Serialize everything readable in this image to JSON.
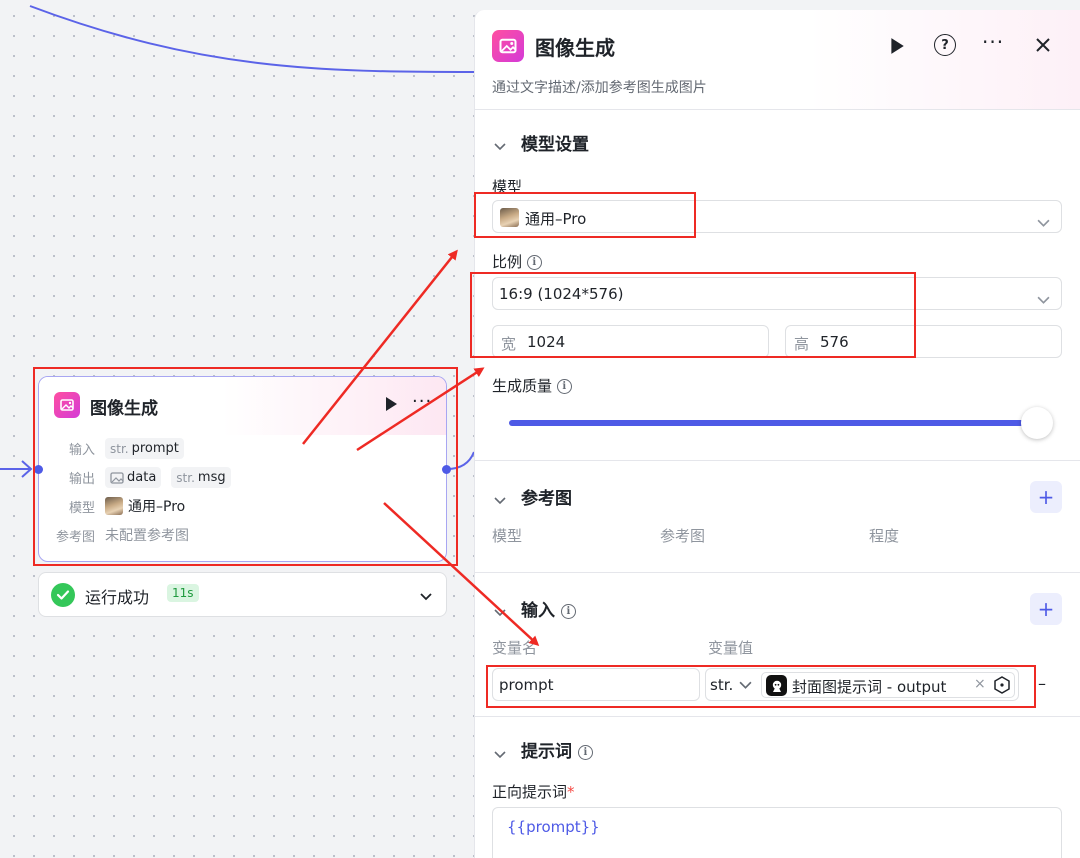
{
  "node": {
    "title": "图像生成",
    "input_label": "输入",
    "output_label": "输出",
    "model_label": "模型",
    "ref_label": "参考图",
    "input_var": {
      "type": "str.",
      "name": "prompt"
    },
    "outputs": [
      {
        "icon": "image-icon",
        "name": "data"
      },
      {
        "type": "str.",
        "name": "msg"
      }
    ],
    "model_value": "通用–Pro",
    "ref_value": "未配置参考图"
  },
  "status": {
    "text": "运行成功",
    "duration": "11s",
    "color": "#34c759"
  },
  "panel": {
    "title": "图像生成",
    "description": "通过文字描述/添加参考图生成图片",
    "model_section": {
      "title": "模型设置",
      "model_label": "模型",
      "model_value": "通用–Pro",
      "ratio_label": "比例",
      "ratio_value": "16:9 (1024*576)",
      "width_prefix": "宽",
      "width_value": "1024",
      "height_prefix": "高",
      "height_value": "576",
      "quality_label": "生成质量",
      "quality_level": 1.0
    },
    "reference_section": {
      "title": "参考图",
      "columns": [
        "模型",
        "参考图",
        "程度"
      ]
    },
    "input_section": {
      "title": "输入",
      "col_name": "变量名",
      "col_value": "变量值",
      "var_name": "prompt",
      "var_type": "str.",
      "var_source": "封面图提示词 - output",
      "remove_symbol": "–"
    },
    "prompt_section": {
      "title": "提示词",
      "positive_label": "正向提示词",
      "required_mark": "*",
      "positive_value": "{{prompt}}"
    }
  },
  "colors": {
    "accent": "#4e5ae6",
    "brand_pink": "#e0409c",
    "annotation_red": "#ee2a24"
  }
}
